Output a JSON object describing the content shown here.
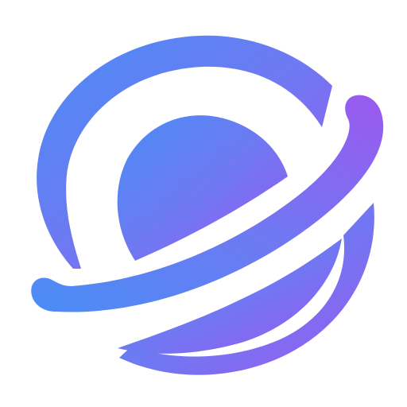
{
  "logo": {
    "icon": "planet-orbit-logo-icon",
    "colors": {
      "gradient_start": "#4A8DF6",
      "gradient_mid": "#6E79F2",
      "gradient_end": "#9B59F0",
      "background": "#FFFFFF"
    }
  }
}
